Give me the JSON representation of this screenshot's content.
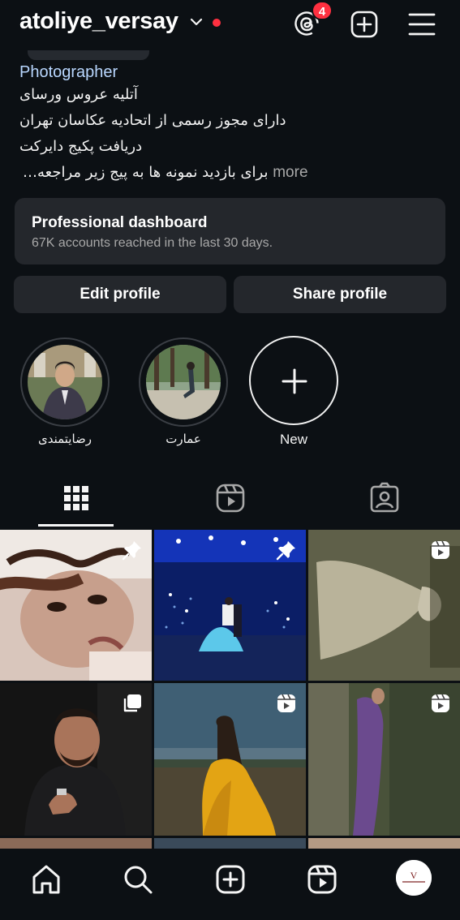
{
  "header": {
    "username": "atoliye_versay",
    "notification_count": "4",
    "icons": [
      "chevron-down-icon",
      "threads-icon",
      "add-post-icon",
      "menu-icon"
    ],
    "colors": {
      "background": "#0c1014",
      "badge": "#ff3040",
      "link": "#b9d7ff"
    }
  },
  "bio": {
    "category": "Photographer",
    "line1": "آتلیه عروس ورسای",
    "line2": "دارای مجوز رسمی از اتحادیه عکاسان تهران",
    "line3": "دریافت پکیج دایرکت",
    "line4": "برای بازدید نمونه ها به پیج زیر مراجعه…",
    "more": "more"
  },
  "dashboard": {
    "title": "Professional dashboard",
    "subtitle": "67K accounts reached in the last 30 days."
  },
  "buttons": {
    "edit": "Edit profile",
    "share": "Share profile"
  },
  "highlights": {
    "items": [
      {
        "label": "رضایتمندی"
      },
      {
        "label": "عمارت"
      }
    ],
    "new_label": "New"
  },
  "tabs": [
    "grid-tab",
    "reels-tab",
    "tagged-tab"
  ],
  "grid": {
    "posts": [
      {
        "badge": "pin-icon"
      },
      {
        "badge": "pin-icon"
      },
      {
        "badge": "reel-icon"
      },
      {
        "badge": "carousel-icon"
      },
      {
        "badge": "reel-icon"
      },
      {
        "badge": "reel-icon"
      }
    ]
  },
  "bottom_nav": [
    "home-icon",
    "search-icon",
    "create-icon",
    "reels-icon",
    "profile-avatar"
  ]
}
